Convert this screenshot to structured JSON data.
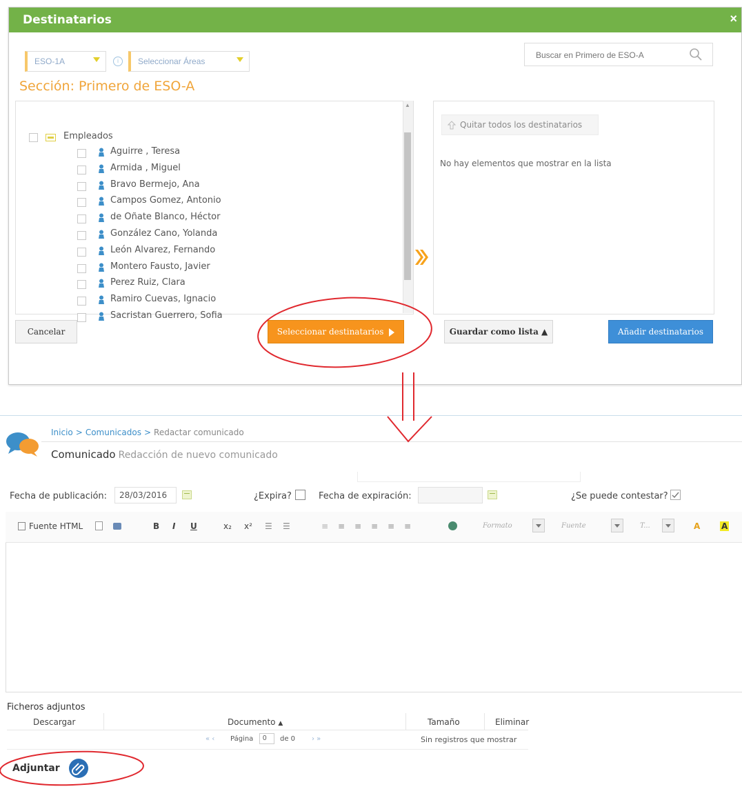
{
  "dialog": {
    "title": "Destinatarios",
    "close": "×",
    "group_select": "ESO-1A",
    "area_select": "Seleccionar Áreas",
    "search_placeholder": "Buscar en Primero de ESO-A",
    "section_title": "Sección: Primero de ESO-A",
    "tree": {
      "group_label": "Empleados",
      "people": [
        "Aguirre , Teresa",
        "Armida , Miguel",
        "Bravo Bermejo, Ana",
        "Campos Gomez, Antonio",
        "de Oñate Blanco, Héctor",
        "González Cano, Yolanda",
        "León Alvarez, Fernando",
        "Montero Fausto, Javier",
        "Perez Ruiz, Clara",
        "Ramiro Cuevas, Ignacio",
        "Sacristan Guerrero, Sofia"
      ]
    },
    "remove_all_label": "Quitar todos los destinatarios",
    "empty_message": "No hay elementos que mostrar en la lista",
    "buttons": {
      "cancel": "Cancelar",
      "select": "Seleccionar destinatarios",
      "save_list": "Guardar como lista ▲",
      "add": "Añadir destinatarios"
    }
  },
  "page": {
    "breadcrumb": [
      "Inicio",
      "Comunicados",
      "Redactar comunicado"
    ],
    "breadcrumb_sep": ">",
    "title": "Comunicado",
    "subtitle": "Redacción de nuevo comunicado",
    "form": {
      "pub_date_label": "Fecha de publicación:",
      "pub_date_value": "28/03/2016",
      "expires_label": "¿Expira?",
      "exp_date_label": "Fecha de expiración:",
      "exp_date_value": "",
      "can_reply_label": "¿Se puede contestar?",
      "can_reply_checked": true,
      "expires_checked": false
    },
    "toolbar": {
      "html_source": "Fuente HTML",
      "bold": "B",
      "italic": "I",
      "underline": "U",
      "subscript": "x₂",
      "superscript": "x²",
      "format": "Formato",
      "font": "Fuente",
      "size": "T..."
    },
    "attachments": {
      "title": "Ficheros adjuntos",
      "columns": [
        "Descargar",
        "Documento",
        "Tamaño",
        "Eliminar"
      ],
      "pager_page_label": "Página",
      "pager_page_value": "0",
      "pager_of": "de 0",
      "empty": "Sin registros que mostrar",
      "attach_label": "Adjuntar"
    }
  },
  "colors": {
    "header_green": "#73b248",
    "orange": "#f7941d",
    "blue": "#3e8fd8",
    "annotation_red": "#e0282e"
  }
}
